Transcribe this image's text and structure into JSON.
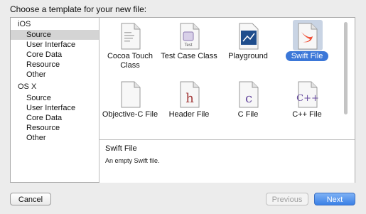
{
  "dialog": {
    "title": "Choose a template for your new file:"
  },
  "sidebar": {
    "ios_label": "iOS",
    "ios_items": [
      "Source",
      "User Interface",
      "Core Data",
      "Resource",
      "Other"
    ],
    "osx_label": "OS X",
    "osx_items": [
      "Source",
      "User Interface",
      "Core Data",
      "Resource",
      "Other"
    ],
    "selected": "iOS/Source"
  },
  "templates": [
    {
      "label": "Cocoa Touch Class",
      "icon": "swift-document-icon"
    },
    {
      "label": "Test Case Class",
      "icon": "test-case-document-icon"
    },
    {
      "label": "Playground",
      "icon": "playground-icon"
    },
    {
      "label": "Swift File",
      "icon": "swift-file-icon",
      "selected": true
    },
    {
      "label": "Objective-C File",
      "icon": "blank-document-icon"
    },
    {
      "label": "Header File",
      "icon": "header-h-icon"
    },
    {
      "label": "C File",
      "icon": "c-file-icon"
    },
    {
      "label": "C++ File",
      "icon": "cpp-file-icon"
    }
  ],
  "description": {
    "title": "Swift File",
    "text": "An empty Swift file."
  },
  "buttons": {
    "cancel": "Cancel",
    "previous": "Previous",
    "next": "Next"
  },
  "colors": {
    "accent": "#3b77d8",
    "selection_bg": "#c9d4e4",
    "swift_orange": "#f05138",
    "header_red": "#a33a3a",
    "c_purple": "#6a4ea0"
  }
}
